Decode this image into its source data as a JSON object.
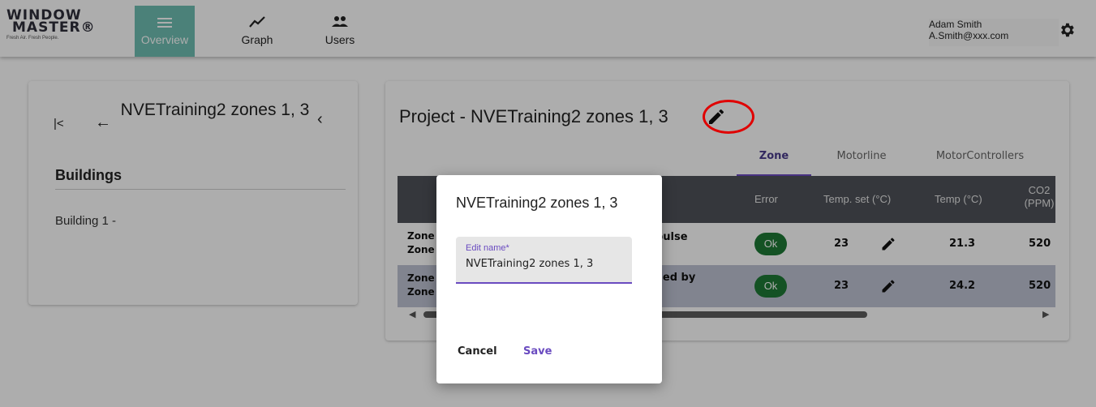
{
  "brand": {
    "line1": "WINDOW",
    "line2": "MASTER®",
    "tagline": "Fresh Air. Fresh People."
  },
  "nav": [
    {
      "label": "Overview",
      "icon": "menu-icon",
      "active": true
    },
    {
      "label": "Graph",
      "icon": "trend-icon",
      "active": false
    },
    {
      "label": "Users",
      "icon": "users-icon",
      "active": false
    }
  ],
  "user": {
    "name": "Adam Smith",
    "email": "A.Smith@xxx.com"
  },
  "left_panel": {
    "title": "NVETraining2 zones 1, 3",
    "section_heading": "Buildings",
    "buildings": [
      "Building 1 -"
    ]
  },
  "project": {
    "title": "Project - NVETraining2 zones 1, 3",
    "tabs": [
      "Zone",
      "Motorline",
      "MotorControllers"
    ],
    "active_tab": "Zone",
    "columns": [
      "Error",
      "Temp. set (°C)",
      "Temp (°C)",
      "CO2 (PPM)"
    ],
    "rows": [
      {
        "zone_line1": "Zone",
        "zone_line2": "Zone",
        "control_text": "pulse",
        "error": "Ok",
        "temp_set": "23",
        "temp": "21.3",
        "co2": "520"
      },
      {
        "zone_line1": "Zone",
        "zone_line2": "Zone",
        "control_text": "lled by",
        "error": "Ok",
        "temp_set": "23",
        "temp": "24.2",
        "co2": "520"
      }
    ]
  },
  "dialog": {
    "title": "NVETraining2 zones 1, 3",
    "field_label": "Edit name*",
    "field_value": "NVETraining2 zones 1, 3",
    "cancel_label": "Cancel",
    "save_label": "Save"
  },
  "colors": {
    "accent_teal": "#6fbfb3",
    "accent_purple": "#6a4bc0",
    "ok_green": "#1e7a36",
    "table_header": "#4e5259",
    "highlight_ring": "#e00000"
  }
}
